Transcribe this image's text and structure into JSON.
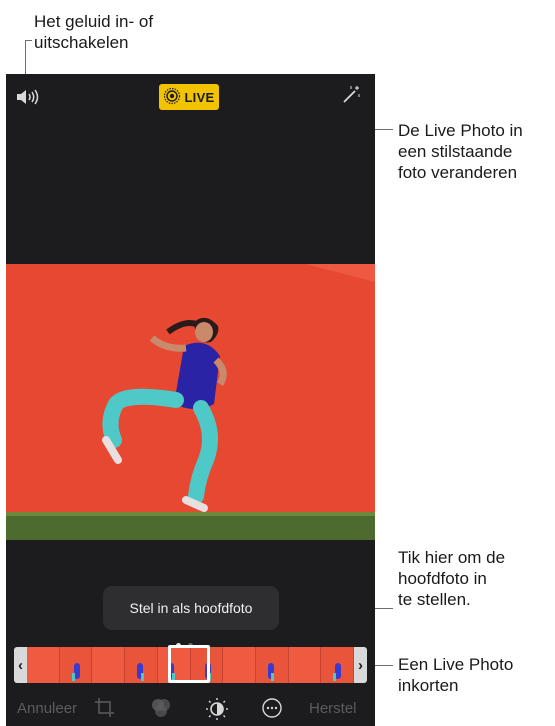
{
  "callouts": {
    "sound": "Het geluid in- of\nuitschakelen",
    "live": "De Live Photo in\neen stilstaande\nfoto veranderen",
    "keyphoto": "Tik hier om de\nhoofdfoto in\nte stellen.",
    "trim": "Een Live Photo\ninkorten"
  },
  "topbar": {
    "live_badge_label": "LIVE",
    "left_icon": "speaker-icon",
    "right_icon": "magic-wand-icon"
  },
  "tooltip": {
    "label": "Stel in als hoofdfoto"
  },
  "bottombar": {
    "cancel_label": "Annuleer",
    "revert_label": "Herstel",
    "icons": [
      "crop-icon",
      "filters-icon",
      "adjust-icon",
      "more-icon"
    ]
  },
  "colors": {
    "live_badge": "#f2c300",
    "wall": "#ec4b33",
    "grass": "#4d6b2e",
    "ui_background": "#1c1c1e"
  }
}
